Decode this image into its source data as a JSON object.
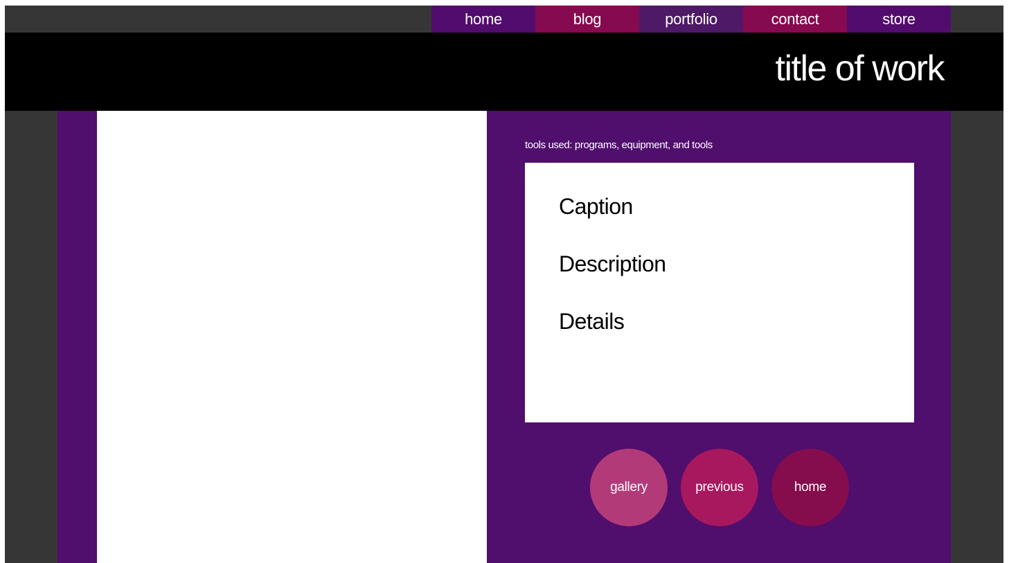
{
  "nav": {
    "items": [
      {
        "label": "home",
        "color": "#520c6e"
      },
      {
        "label": "blog",
        "color": "#860a4f"
      },
      {
        "label": "portfolio",
        "color": "#4e1966"
      },
      {
        "label": "contact",
        "color": "#860a4f"
      },
      {
        "label": "store",
        "color": "#520c6e"
      }
    ]
  },
  "header": {
    "title": "title of work"
  },
  "info": {
    "tools_label": "tools used: programs, equipment, and tools",
    "caption": "Caption",
    "description": "Description",
    "details": "Details"
  },
  "actions": {
    "gallery": {
      "label": "gallery",
      "color": "#b33a78"
    },
    "previous": {
      "label": "previous",
      "color": "#a8185e"
    },
    "home": {
      "label": "home",
      "color": "#850c4d"
    }
  },
  "colors": {
    "background": "#363636",
    "header": "#000000",
    "content_panel": "#500e6d",
    "card": "#ffffff"
  }
}
